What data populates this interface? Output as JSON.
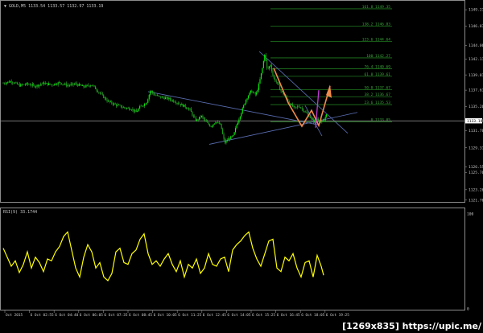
{
  "header": {
    "symbol": "▼ GOLD,M5 1133.54 1133.57 1132.97 1133.19"
  },
  "chart_data": [
    {
      "type": "candlestick",
      "symbol": "GOLD",
      "timeframe": "M5",
      "ylim": [
        1121.5,
        1150.5
      ],
      "y_ticks": [
        1149.21,
        1146.87,
        1144.06,
        1142.11,
        1139.81,
        1137.61,
        1135.26,
        1133.19,
        1131.76,
        1129.31,
        1126.55,
        1125.76,
        1123.26,
        1121.76
      ],
      "current_price": 1133.19,
      "x_ticks": [
        "Oct 2015",
        "6 Oct 02:55",
        "6 Oct 04:40",
        "6 Oct 06:05",
        "6 Oct 07:35",
        "6 Oct 08:45",
        "6 Oct 10:05",
        "6 Oct 11:25",
        "6 Oct 12:45",
        "6 Oct 14:05",
        "6 Oct 15:25",
        "6 Oct 16:45",
        "6 Oct 18:05",
        "6 Oct 19:25"
      ],
      "close_path": [
        [
          0,
          1138.6
        ],
        [
          10,
          1138.9
        ],
        [
          20,
          1138.3
        ],
        [
          30,
          1138.5
        ],
        [
          40,
          1138.2
        ],
        [
          50,
          1138.6
        ],
        [
          60,
          1138.4
        ],
        [
          70,
          1138.7
        ],
        [
          80,
          1138.3
        ],
        [
          90,
          1138.5
        ],
        [
          100,
          1138.1
        ],
        [
          110,
          1138.4
        ],
        [
          120,
          1137.2
        ],
        [
          130,
          1136.0
        ],
        [
          140,
          1135.5
        ],
        [
          150,
          1135.1
        ],
        [
          160,
          1134.9
        ],
        [
          165,
          1134.4
        ],
        [
          170,
          1135.2
        ],
        [
          178,
          1135.8
        ],
        [
          183,
          1137.6
        ],
        [
          188,
          1136.9
        ],
        [
          196,
          1136.6
        ],
        [
          205,
          1136.4
        ],
        [
          215,
          1135.9
        ],
        [
          225,
          1135.3
        ],
        [
          232,
          1134.8
        ],
        [
          236,
          1133.8
        ],
        [
          240,
          1133.2
        ],
        [
          246,
          1133.9
        ],
        [
          252,
          1133.0
        ],
        [
          258,
          1132.4
        ],
        [
          264,
          1133.1
        ],
        [
          270,
          1132.6
        ],
        [
          275,
          1130.0
        ],
        [
          280,
          1130.6
        ],
        [
          286,
          1131.0
        ],
        [
          290,
          1132.6
        ],
        [
          296,
          1134.5
        ],
        [
          302,
          1136.4
        ],
        [
          308,
          1137.5
        ],
        [
          314,
          1136.9
        ],
        [
          318,
          1138.6
        ],
        [
          322,
          1140.8
        ],
        [
          325,
          1143.0
        ],
        [
          328,
          1140.5
        ],
        [
          332,
          1141.3
        ],
        [
          336,
          1139.3
        ],
        [
          340,
          1138.7
        ],
        [
          345,
          1137.5
        ],
        [
          350,
          1136.8
        ],
        [
          355,
          1135.8
        ],
        [
          362,
          1135.0
        ],
        [
          368,
          1135.3
        ],
        [
          374,
          1134.6
        ],
        [
          380,
          1133.9
        ],
        [
          385,
          1133.1
        ],
        [
          390,
          1133.5
        ],
        [
          394,
          1133.1
        ],
        [
          398,
          1133.0
        ],
        [
          402,
          1134.4
        ]
      ],
      "fibonacci_levels": [
        {
          "label": "161.8 1149.35",
          "price": 1149.35
        },
        {
          "label": "138.2 1146.83",
          "price": 1146.83
        },
        {
          "label": "123.6 1144.64",
          "price": 1144.64
        },
        {
          "label": "100 1142.27",
          "price": 1142.27
        },
        {
          "label": "76.4 1140.69",
          "price": 1140.69
        },
        {
          "label": "61.8 1139.61",
          "price": 1139.61
        },
        {
          "label": "50.0 1137.67",
          "price": 1137.67
        },
        {
          "label": "38.2 1136.67",
          "price": 1136.67
        },
        {
          "label": "23.6 1135.53",
          "price": 1135.53
        },
        {
          "label": "0 1133.05",
          "price": 1133.05
        }
      ]
    },
    {
      "type": "line",
      "name": "RSI(9) 33.1744",
      "ylim": [
        0,
        100
      ],
      "y_ticks": [
        100,
        0
      ],
      "x": [
        0,
        5,
        10,
        15,
        20,
        25,
        30,
        35,
        40,
        45,
        50,
        55,
        60,
        65,
        70,
        75,
        80,
        85,
        90,
        95,
        100,
        105,
        110,
        115,
        120,
        125,
        130,
        135,
        140,
        145,
        150,
        155,
        160,
        165,
        170,
        175,
        180,
        185,
        190,
        195,
        200,
        205,
        210,
        215,
        220,
        225,
        230,
        235,
        240,
        245,
        250,
        255,
        260,
        265,
        270,
        275,
        280,
        285,
        290,
        295,
        300,
        305,
        310,
        315,
        320,
        325,
        330,
        335,
        340,
        345,
        350,
        355,
        360,
        365,
        370,
        375,
        380,
        385,
        390,
        395,
        398
      ],
      "values": [
        62,
        52,
        42,
        48,
        35,
        44,
        58,
        40,
        52,
        46,
        36,
        50,
        48,
        58,
        64,
        75,
        80,
        60,
        40,
        30,
        52,
        66,
        58,
        40,
        46,
        30,
        26,
        34,
        58,
        62,
        46,
        44,
        56,
        60,
        72,
        78,
        56,
        44,
        48,
        42,
        50,
        56,
        44,
        36,
        48,
        30,
        44,
        40,
        50,
        34,
        40,
        56,
        44,
        42,
        50,
        52,
        36,
        60,
        66,
        70,
        76,
        80,
        62,
        50,
        42,
        56,
        70,
        72,
        40,
        36,
        52,
        48,
        56,
        40,
        30,
        46,
        48,
        30,
        54,
        42,
        32
      ]
    }
  ]
}
